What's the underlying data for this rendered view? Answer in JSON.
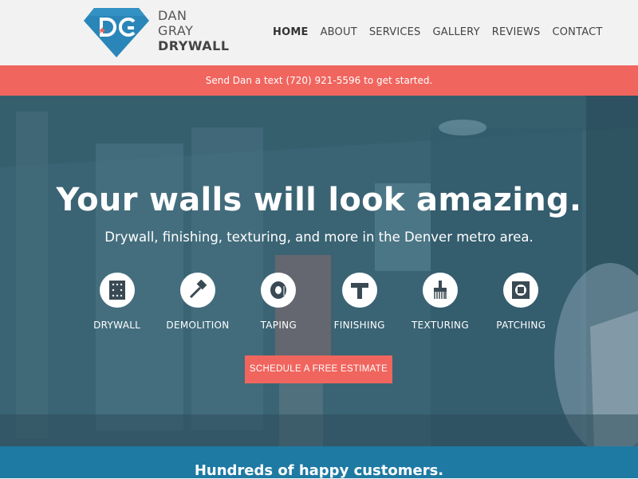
{
  "brand": {
    "monogram": "DG",
    "line1": "DAN",
    "line2": "GRAY",
    "line3": "DRYWALL",
    "colors": {
      "diamond": "#2a86b8",
      "accent": "#f0655e"
    }
  },
  "nav": {
    "items": [
      {
        "label": "HOME",
        "active": true
      },
      {
        "label": "ABOUT"
      },
      {
        "label": "SERVICES"
      },
      {
        "label": "GALLERY"
      },
      {
        "label": "REVIEWS"
      },
      {
        "label": "CONTACT"
      }
    ]
  },
  "banner": {
    "text": "Send Dan a text (720) 921-5596 to get started."
  },
  "hero": {
    "title": "Your walls will look amazing.",
    "subtitle": "Drywall, finishing, texturing, and more in the Denver metro area.",
    "services": [
      {
        "label": "DRYWALL",
        "icon": "drywall-board-icon"
      },
      {
        "label": "DEMOLITION",
        "icon": "hammer-icon"
      },
      {
        "label": "TAPING",
        "icon": "tape-roll-icon"
      },
      {
        "label": "FINISHING",
        "icon": "trowel-icon"
      },
      {
        "label": "TEXTURING",
        "icon": "brush-icon"
      },
      {
        "label": "PATCHING",
        "icon": "patch-square-icon"
      }
    ],
    "cta_label": "SCHEDULE A FREE ESTIMATE"
  },
  "testimonials": {
    "title": "Hundreds of happy customers."
  }
}
